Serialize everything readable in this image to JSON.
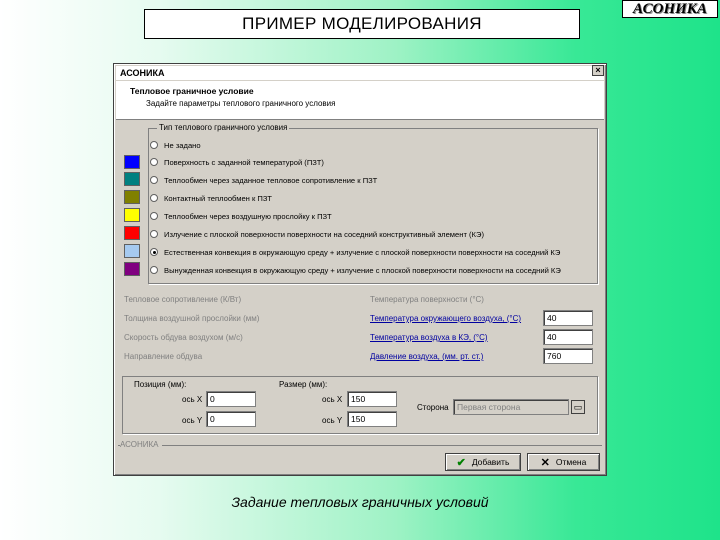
{
  "slide": {
    "title": "ПРИМЕР МОДЕЛИРОВАНИЯ",
    "logo": "АСОНИКА",
    "caption": "Задание тепловых граничных условий"
  },
  "window": {
    "title": "АСОНИКА",
    "close": "×",
    "header_title": "Тепловое граничное условие",
    "header_subtitle": "Задайте параметры теплового граничного условия"
  },
  "boundary_group": {
    "legend": "Тип теплового граничного условия",
    "options": [
      {
        "label": "Не задано",
        "color": null,
        "checked": false
      },
      {
        "label": "Поверхность с заданной температурой (ПЗТ)",
        "color": "#0000ff",
        "checked": false
      },
      {
        "label": "Теплообмен через заданное тепловое сопротивление к ПЗТ",
        "color": "#008080",
        "checked": false
      },
      {
        "label": "Контактный теплообмен к ПЗТ",
        "color": "#808000",
        "checked": false
      },
      {
        "label": "Теплообмен через воздушную прослойку к ПЗТ",
        "color": "#ffff00",
        "checked": false
      },
      {
        "label": "Излучение с плоской поверхности поверхности на соседний конструктивный элемент (КЭ)",
        "color": "#ff0000",
        "checked": false
      },
      {
        "label": "Естественная конвекция в окружающую среду + излучение с плоской поверхности поверхности на соседний КЭ",
        "color": "#a6caf0",
        "checked": true
      },
      {
        "label": "Вынужденная конвекция в окружающую среду + излучение с плоской поверхности поверхности на соседний КЭ",
        "color": "#800080",
        "checked": false
      }
    ]
  },
  "params_left": [
    {
      "label": "Тепловое сопротивление (К/Вт)"
    },
    {
      "label": "Толщина воздушной прослойки (мм)"
    },
    {
      "label": "Скорость обдува воздухом (м/с)"
    },
    {
      "label": "Направление обдува"
    }
  ],
  "params_right": [
    {
      "label": "Температура поверхности (°С)",
      "value": "",
      "link": false
    },
    {
      "label": "Температура окружающего воздуха, (°С)",
      "value": "40",
      "link": true
    },
    {
      "label": "Температура воздуха в КЭ, (°С)",
      "value": "40",
      "link": true
    },
    {
      "label": "Давление воздуха, (мм. рт. ст.)",
      "value": "760",
      "link": true
    }
  ],
  "geometry_group": {
    "coords_label": "Позиция (мм):",
    "size_label": "Размер (мм):",
    "x_axis_label": "ось X",
    "y_axis_label": "ось Y",
    "pos_x": "0",
    "pos_y": "0",
    "size_x": "150",
    "size_y": "150",
    "side_label": "Сторона",
    "side_value": "Первая сторона"
  },
  "footer": {
    "brand": "АСОНИКА",
    "ok_label": "Добавить",
    "cancel_label": "Отмена"
  },
  "colors": {
    "link": "#0000a0",
    "dialog_bg": "#d4d0c8"
  }
}
